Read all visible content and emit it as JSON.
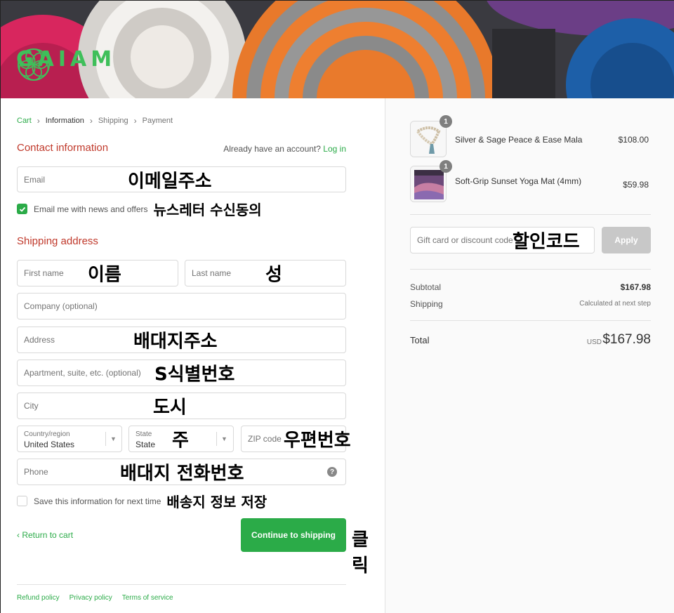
{
  "brand": {
    "name": "GAIAM",
    "color": "#3fbf5a",
    "logo_icon": "flower-of-life-icon"
  },
  "breadcrumb": [
    {
      "label": "Cart"
    },
    {
      "label": "Information"
    },
    {
      "label": "Shipping"
    },
    {
      "label": "Payment"
    }
  ],
  "contact": {
    "heading": "Contact information",
    "already_text": "Already have an account?",
    "login_link": "Log in",
    "email_placeholder": "Email",
    "email_annotation": "이메일주소",
    "newsletter_label": "Email me with news and offers",
    "newsletter_checked": true,
    "newsletter_annotation": "뉴스레터 수신동의"
  },
  "shipping": {
    "heading": "Shipping address",
    "first_name_placeholder": "First name",
    "first_name_annotation": "이름",
    "last_name_placeholder": "Last name",
    "last_name_annotation": "성",
    "company_placeholder": "Company (optional)",
    "address_placeholder": "Address",
    "address_annotation": "배대지주소",
    "apartment_placeholder": "Apartment, suite, etc. (optional)",
    "apartment_annotation": "S식별번호",
    "city_placeholder": "City",
    "city_annotation": "도시",
    "country_label": "Country/region",
    "country_value": "United States",
    "state_label": "State",
    "state_value": "State",
    "state_annotation": "주",
    "zip_placeholder": "ZIP code",
    "zip_annotation": "우편번호",
    "phone_placeholder": "Phone",
    "phone_annotation": "배대지 전화번호",
    "save_label": "Save this information for next time",
    "save_checked": false,
    "save_annotation": "배송지 정보 저장"
  },
  "actions": {
    "return_label": "Return to cart",
    "continue_label": "Continue to shipping",
    "continue_annotation": "클릭",
    "accent": "#2bab48"
  },
  "footer": {
    "links": [
      "Refund policy",
      "Privacy policy",
      "Terms of service"
    ]
  },
  "summary": {
    "products": [
      {
        "name": "Silver & Sage Peace & Ease Mala",
        "price": "$108.00",
        "qty": "1"
      },
      {
        "name": "Soft-Grip Sunset Yoga Mat (4mm)",
        "price": "$59.98",
        "qty": "1"
      }
    ],
    "discount_placeholder": "Gift card or discount code",
    "discount_annotation": "할인코드",
    "apply_label": "Apply",
    "subtotal_label": "Subtotal",
    "subtotal_value": "$167.98",
    "shipping_label": "Shipping",
    "shipping_value": "Calculated at next step",
    "total_label": "Total",
    "total_currency": "USD",
    "total_value": "$167.98"
  }
}
